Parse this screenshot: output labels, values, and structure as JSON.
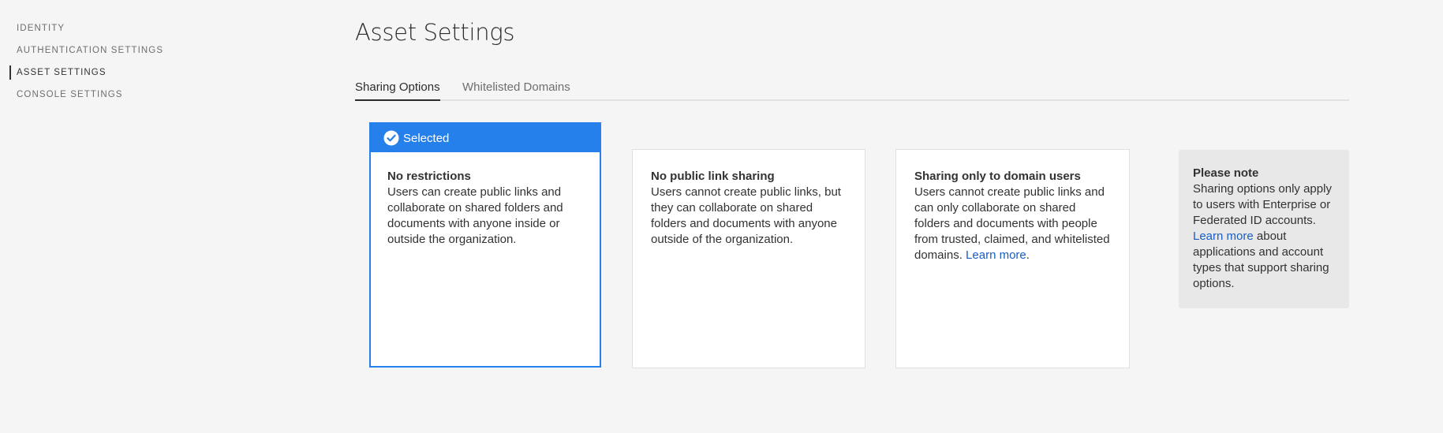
{
  "sidebar": {
    "items": [
      {
        "label": "IDENTITY",
        "active": false
      },
      {
        "label": "AUTHENTICATION SETTINGS",
        "active": false
      },
      {
        "label": "ASSET SETTINGS",
        "active": true
      },
      {
        "label": "CONSOLE SETTINGS",
        "active": false
      }
    ]
  },
  "page": {
    "title": "Asset Settings"
  },
  "tabs": [
    {
      "label": "Sharing Options",
      "active": true
    },
    {
      "label": "Whitelisted Domains",
      "active": false
    }
  ],
  "cards": [
    {
      "selected": true,
      "selected_label": "Selected",
      "title": "No restrictions",
      "description": "Users can create public links and collaborate on shared folders and documents with anyone inside or outside the organization."
    },
    {
      "selected": false,
      "title": "No public link sharing",
      "description": "Users cannot create public links, but they can collaborate on shared folders and documents with anyone outside of the organization."
    },
    {
      "selected": false,
      "title": "Sharing only to domain users",
      "description": "Users cannot create public links and can only collaborate on shared folders and documents with people from trusted, claimed, and whitelisted domains.",
      "link": "Learn more",
      "link_suffix": "."
    }
  ],
  "note": {
    "title": "Please note",
    "text": "Sharing options only apply to users with Enterprise or Federated ID accounts.",
    "link": "Learn more",
    "link_suffix": " about applications and account types that support sharing options."
  },
  "colors": {
    "accent": "#2680eb",
    "link": "#1a5ec2",
    "background": "#f5f5f5"
  }
}
